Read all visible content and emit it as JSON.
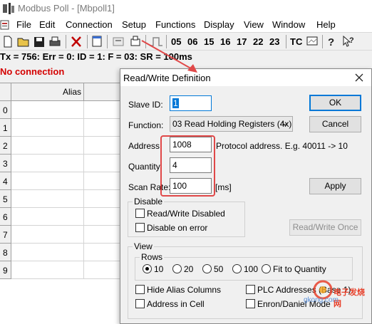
{
  "window": {
    "title": "Modbus Poll - [Mbpoll1]"
  },
  "menu": [
    "File",
    "Edit",
    "Connection",
    "Setup",
    "Functions",
    "Display",
    "View",
    "Window",
    "Help"
  ],
  "toolbar": {
    "codes": [
      "05",
      "06",
      "15",
      "16",
      "17",
      "22",
      "23"
    ],
    "tc": "TC"
  },
  "status": {
    "line": "Tx = 756: Err = 0: ID = 1: F = 03: SR = 100ms",
    "connection": "No connection"
  },
  "grid": {
    "column": "Alias",
    "rows": [
      "0",
      "1",
      "2",
      "3",
      "4",
      "5",
      "6",
      "7",
      "8",
      "9"
    ]
  },
  "dialog": {
    "title": "Read/Write Definition",
    "slave_id_label": "Slave ID:",
    "slave_id": "1",
    "function_label": "Function:",
    "function_value": "03 Read Holding Registers (4x)",
    "address_label": "Address:",
    "address": "1008",
    "address_hint": "Protocol address. E.g. 40011 -> 10",
    "quantity_label": "Quantity:",
    "quantity": "4",
    "scan_rate_label": "Scan Rate:",
    "scan_rate": "100",
    "scan_rate_unit": "[ms]",
    "ok": "OK",
    "cancel": "Cancel",
    "apply": "Apply",
    "read_write_once": "Read/Write Once",
    "disable_group": "Disable",
    "rw_disabled": "Read/Write Disabled",
    "disable_on_error": "Disable on error",
    "view_group": "View",
    "rows_group": "Rows",
    "rows_options": [
      "10",
      "20",
      "50",
      "100",
      "Fit to Quantity"
    ],
    "rows_selected": "10",
    "hide_alias": "Hide Alias Columns",
    "address_in_cell": "Address in Cell",
    "plc_addresses": "PLC Addresses (Base 1)",
    "enron": "Enron/Daniel Mode"
  },
  "watermark": {
    "text": "电子发烧网",
    "url": "gkong.com"
  },
  "colors": {
    "accent": "#0078d7",
    "annotation": "#e04848",
    "error": "#d40000"
  }
}
